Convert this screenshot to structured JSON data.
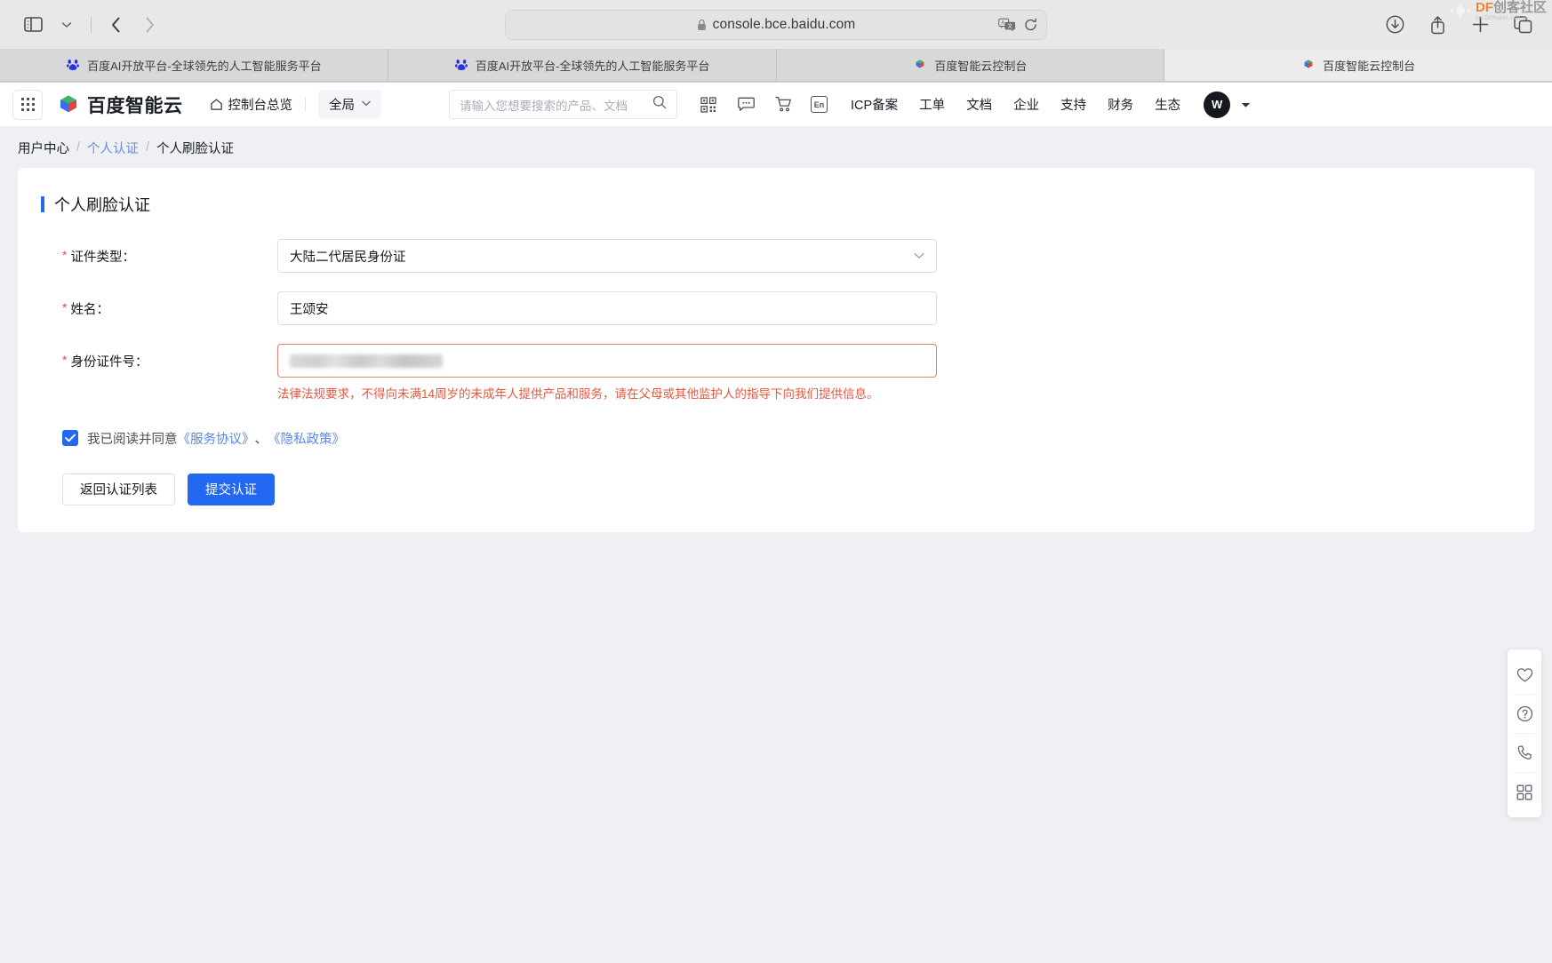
{
  "browser": {
    "url": "console.bce.baidu.com",
    "lock_icon": "lock-icon",
    "sidebar_icon": "sidebar-toggle-icon",
    "back_label": "‹",
    "forward_label": "›",
    "translate_icon": "translate-icon",
    "reload_icon": "reload-icon",
    "download_icon": "download-icon",
    "share_icon": "share-icon",
    "new_tab_icon": "plus-icon",
    "tabs_overview_icon": "tab-overview-icon",
    "watermark": {
      "main": "DF",
      "main_cn": "创客社区",
      "sub": "mc.DFRobot.com.cn"
    },
    "tabs": [
      {
        "title": "百度AI开放平台-全球领先的人工智能服务平台",
        "favicon": "baidu-paw-icon",
        "active": false
      },
      {
        "title": "百度AI开放平台-全球领先的人工智能服务平台",
        "favicon": "baidu-paw-icon",
        "active": false
      },
      {
        "title": "百度智能云控制台",
        "favicon": "baidu-cloud-icon",
        "active": false
      },
      {
        "title": "百度智能云控制台",
        "favicon": "baidu-cloud-icon",
        "active": true
      }
    ]
  },
  "header": {
    "apps_icon": "grid-apps-icon",
    "brand_name": "百度智能云",
    "brand_logo_icon": "baidu-cloud-logo-icon",
    "console_overview": "控制台总览",
    "home_icon": "home-icon",
    "region": "全局",
    "region_caret_icon": "chevron-down-icon",
    "search_placeholder": "请输入您想要搜索的产品、文档",
    "search_icon": "search-icon",
    "icons": [
      {
        "name": "qrcode-icon"
      },
      {
        "name": "message-icon"
      },
      {
        "name": "cart-icon"
      },
      {
        "name": "language-en-icon",
        "label": "En"
      }
    ],
    "nav": [
      "ICP备案",
      "工单",
      "文档",
      "企业",
      "支持",
      "财务",
      "生态"
    ],
    "avatar_initial": "W",
    "avatar_caret_icon": "caret-down-icon"
  },
  "breadcrumb": {
    "items": [
      {
        "label": "用户中心",
        "link": false
      },
      {
        "label": "个人认证",
        "link": true
      },
      {
        "label": "个人刷脸认证",
        "link": false
      }
    ],
    "separator": "/"
  },
  "form": {
    "title": "个人刷脸认证",
    "required_mark": "*",
    "fields": [
      {
        "label": "证件类型：",
        "type": "select",
        "value": "大陆二代居民身份证",
        "caret_icon": "chevron-down-icon",
        "required": true,
        "error": null
      },
      {
        "label": "姓名：",
        "type": "text",
        "value": "王颂安",
        "required": true,
        "error": null
      },
      {
        "label": "身份证件号：",
        "type": "text-redacted",
        "value": "",
        "required": true,
        "error": "法律法规要求，不得向未满14周岁的未成年人提供产品和服务，请在父母或其他监护人的指导下向我们提供信息。"
      }
    ],
    "agreement": {
      "checked": true,
      "prefix": "我已阅读并同意",
      "link1": "《服务协议》",
      "punct": "、",
      "link2": "《隐私政策》",
      "check_icon": "checkmark-icon"
    },
    "buttons": {
      "back": "返回认证列表",
      "submit": "提交认证"
    }
  },
  "dock": {
    "items": [
      {
        "name": "favorite-heart-icon"
      },
      {
        "name": "help-question-icon"
      },
      {
        "name": "phone-icon"
      },
      {
        "name": "apps-grid-icon"
      }
    ]
  },
  "colors": {
    "primary": "#2468f2",
    "error": "#e8573f",
    "link": "#5b86e8",
    "page_bg": "#eef0f4"
  }
}
